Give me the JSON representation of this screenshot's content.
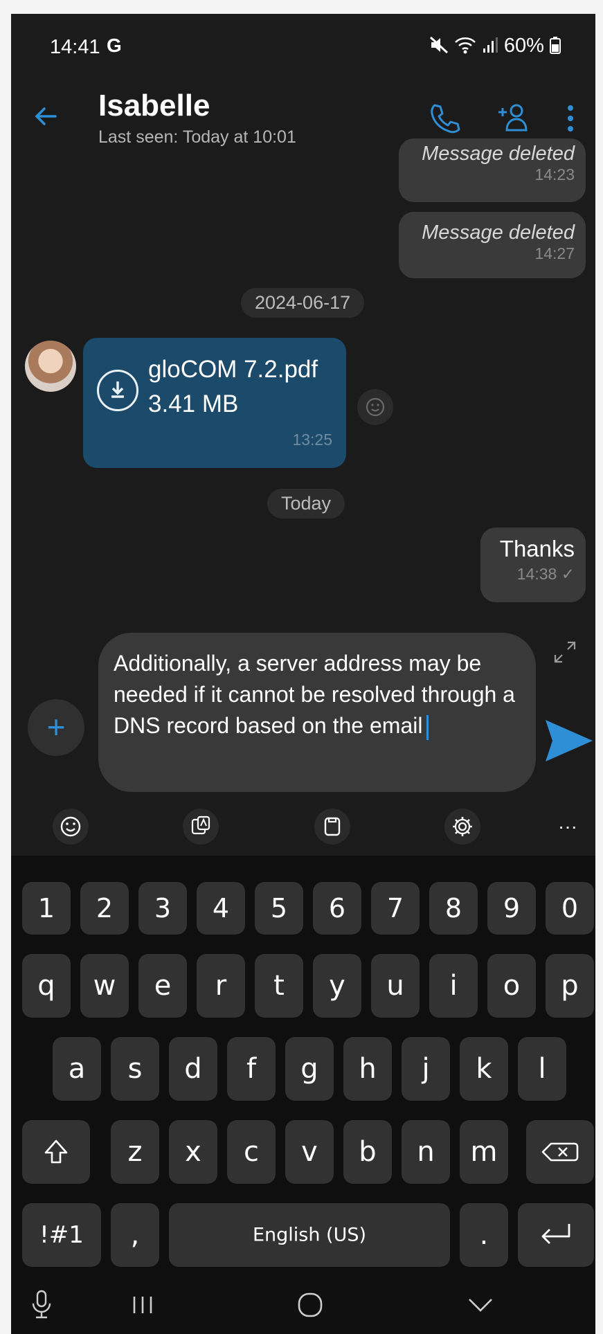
{
  "status_bar": {
    "time": "14:41",
    "app_glyph": "G",
    "battery": "60%"
  },
  "header": {
    "contact_name": "Isabelle",
    "last_seen": "Last seen: Today at 10:01"
  },
  "messages": [
    {
      "text": "Message deleted",
      "time": "14:23"
    },
    {
      "text": "Message deleted",
      "time": "14:27"
    }
  ],
  "date_1": "2024-06-17",
  "file_message": {
    "filename": "gloCOM 7.2.pdf",
    "size": "3.41 MB",
    "time": "13:25"
  },
  "date_2": "Today",
  "outgoing": {
    "text": "Thanks",
    "time": "14:38",
    "check": "✓"
  },
  "composer": {
    "text": "Additionally, a server address may be needed if it cannot be resolved through a DNS record based on the email"
  },
  "keyboard": {
    "row_numbers": [
      "1",
      "2",
      "3",
      "4",
      "5",
      "6",
      "7",
      "8",
      "9",
      "0"
    ],
    "row_1": [
      "q",
      "w",
      "e",
      "r",
      "t",
      "y",
      "u",
      "i",
      "o",
      "p"
    ],
    "row_2": [
      "a",
      "s",
      "d",
      "f",
      "g",
      "h",
      "j",
      "k",
      "l"
    ],
    "row_3": [
      "z",
      "x",
      "c",
      "v",
      "b",
      "n",
      "m"
    ],
    "symbols_key": "!#1",
    "comma_key": ",",
    "space_label": "English (US)",
    "period_key": ".",
    "more_key": "···"
  },
  "colors": {
    "accent": "#2e8fd6",
    "background": "#1b1b1b",
    "file_bubble": "#1b4a6a"
  }
}
